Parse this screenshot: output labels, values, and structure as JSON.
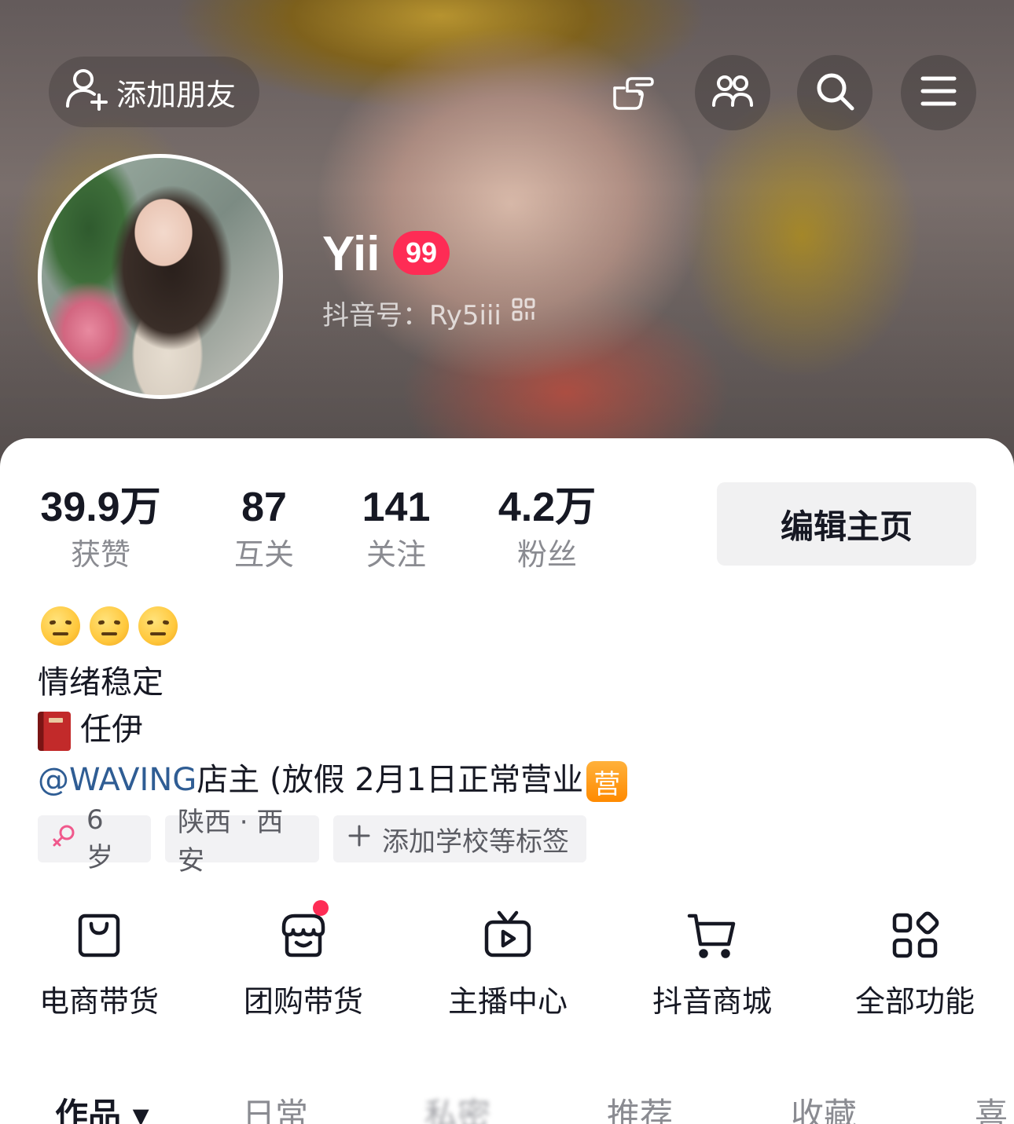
{
  "header": {
    "add_friend_label": "添加朋友",
    "icons": [
      "hand-pointer-icon",
      "friends-icon",
      "search-icon",
      "menu-icon"
    ]
  },
  "profile": {
    "name": "Yii",
    "level": "99",
    "douyin_id": "抖音号：Ry5iii"
  },
  "stats": [
    {
      "value": "39.9万",
      "label": "获赞"
    },
    {
      "value": "87",
      "label": "互关"
    },
    {
      "value": "141",
      "label": "关注"
    },
    {
      "value": "4.2万",
      "label": "粉丝"
    }
  ],
  "edit_button": "编辑主页",
  "bio": {
    "line1": "情绪稳定",
    "line2": "任伊",
    "mention": "@WAVING",
    "line3": "店主 (放假 2月1日正常营业",
    "ying_badge": "营"
  },
  "tags": {
    "age": "6 岁",
    "location": "陕西 · 西安",
    "add_label": "添加学校等标签"
  },
  "features": [
    {
      "label": "电商带货",
      "icon": "shopping-bag-icon"
    },
    {
      "label": "团购带货",
      "icon": "group-buy-icon"
    },
    {
      "label": "主播中心",
      "icon": "tv-play-icon"
    },
    {
      "label": "抖音商城",
      "icon": "cart-icon"
    },
    {
      "label": "全部功能",
      "icon": "grid-icon"
    }
  ],
  "tabs": [
    {
      "label": "作品 ▾"
    },
    {
      "label": "日常"
    },
    {
      "label": "私密"
    },
    {
      "label": "推荐"
    },
    {
      "label": "收藏"
    },
    {
      "label": "喜"
    }
  ],
  "colors": {
    "accent": "#fe2c55",
    "mention": "#2f5d94",
    "ying": "#ff8a00"
  }
}
